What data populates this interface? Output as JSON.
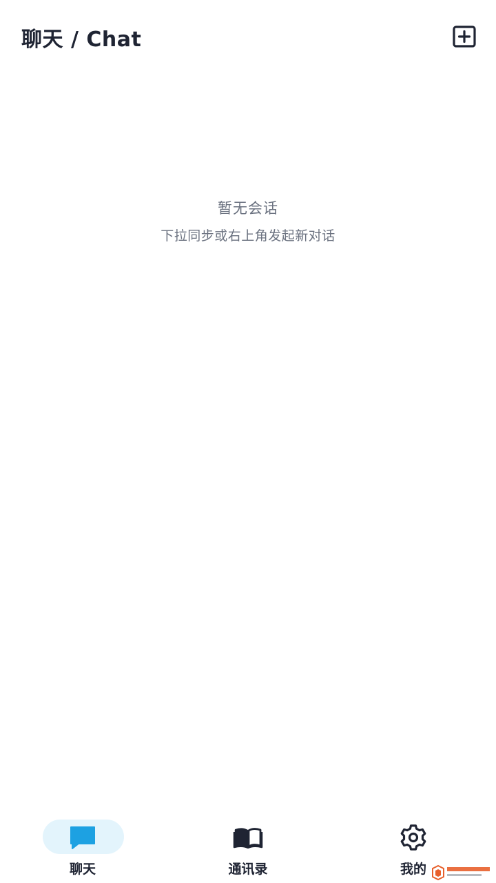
{
  "header": {
    "title": "聊天 / Chat",
    "new_chat_icon": "plus-square-icon"
  },
  "empty_state": {
    "title": "暂无会话",
    "hint": "下拉同步或右上角发起新对话"
  },
  "bottom_nav": {
    "active_index": 0,
    "items": [
      {
        "label": "聊天",
        "icon": "chat-bubble-icon",
        "active": true
      },
      {
        "label": "通讯录",
        "icon": "book-icon",
        "active": false
      },
      {
        "label": "我的",
        "icon": "gear-icon",
        "active": false
      }
    ]
  },
  "colors": {
    "primary_text": "#1f2433",
    "secondary_text": "#6b7280",
    "accent": "#1da1e2",
    "active_pill": "#e3f4fc",
    "background": "#ffffff"
  }
}
